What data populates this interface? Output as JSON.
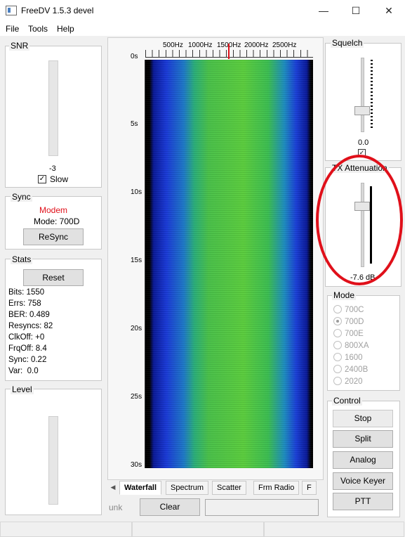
{
  "window": {
    "title": "FreeDV 1.5.3 devel",
    "minimize": "—",
    "maximize": "☐",
    "close": "✕"
  },
  "menu": {
    "items": [
      "File",
      "Tools",
      "Help"
    ]
  },
  "snr": {
    "title": "SNR",
    "value": "-3",
    "slow_label": "Slow",
    "slow_checked": true
  },
  "sync": {
    "title": "Sync",
    "modem_label": "Modem",
    "mode_text": "Mode: 700D",
    "resync_label": "ReSync"
  },
  "stats": {
    "title": "Stats",
    "reset_label": "Reset",
    "lines": [
      "Bits: 1550",
      "Errs: 758",
      "BER: 0.489",
      "Resyncs: 82",
      "ClkOff: +0",
      "FrqOff: 8.4",
      "Sync: 0.22",
      "Var:  0.0"
    ]
  },
  "level": {
    "title": "Level"
  },
  "waterfall": {
    "freq_labels": [
      "500Hz",
      "1000Hz",
      "1500Hz",
      "2000Hz",
      "2500Hz"
    ],
    "time_labels": [
      "0s",
      "5s",
      "10s",
      "15s",
      "20s",
      "25s",
      "30s"
    ]
  },
  "tabs": [
    "Waterfall",
    "Spectrum",
    "Scatter",
    "Frm Radio",
    "F"
  ],
  "bottom": {
    "unk_label": "unk",
    "clear_label": "Clear",
    "text_field_value": ""
  },
  "squelch": {
    "title": "Squelch",
    "value": "0.0",
    "checked": true
  },
  "tx_attenuation": {
    "title": "TX Attenuation",
    "value": "-7.6 dB"
  },
  "mode": {
    "title": "Mode",
    "options": [
      "700C",
      "700D",
      "700E",
      "800XA",
      "1600",
      "2400B",
      "2020"
    ],
    "selected": "700D"
  },
  "control": {
    "title": "Control",
    "buttons": [
      "Stop",
      "Split",
      "Analog",
      "Voice Keyer",
      "PTT"
    ]
  },
  "colors": {
    "annotation_circle": "#e0101a",
    "modem_text": "#e0101a",
    "center_marker": "#e0101a"
  }
}
